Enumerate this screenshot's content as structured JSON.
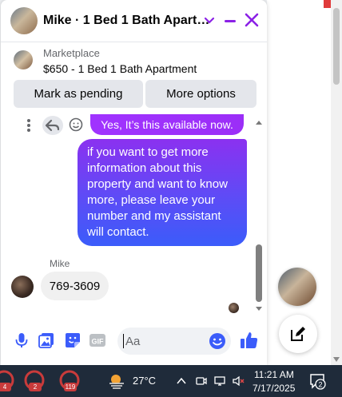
{
  "colors": {
    "accent": "#8b21e6",
    "outgoing": "#5d4cf6",
    "taskbar": "#1f2b3a",
    "incoming": "#f0f0f0"
  },
  "chat": {
    "title": "Mike · 1 Bed 1 Bath Apart…",
    "listing": {
      "source": "Marketplace",
      "name": "$650 - 1 Bed 1 Bath Apartment",
      "primary_action": "Mark as pending",
      "secondary_action": "More options"
    },
    "messages": [
      {
        "direction": "out",
        "text": "Yes, It’s this available now."
      },
      {
        "direction": "out",
        "text": "if you want to get more information about this property and want to know more, please leave your number and my assistant will contact."
      },
      {
        "direction": "in",
        "sender": "Mike",
        "text": "769-3609"
      }
    ],
    "composer": {
      "placeholder": "Aa"
    },
    "icons": [
      "chevron-down-icon",
      "minimize-icon",
      "close-icon",
      "microphone-icon",
      "photo-icon",
      "sticker-icon",
      "gif-icon",
      "emoji-icon",
      "thumbs-up-icon",
      "new-message-icon"
    ]
  },
  "taskbar": {
    "apps": [
      {
        "badge": "4"
      },
      {
        "badge": "2"
      },
      {
        "badge": "119"
      }
    ],
    "temperature": "27°C",
    "time": "11:21 AM",
    "date": "7/17/2025",
    "notifications": "2"
  }
}
